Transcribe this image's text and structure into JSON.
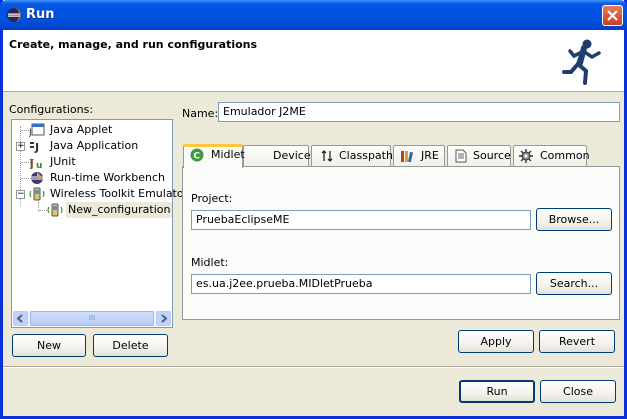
{
  "window": {
    "title": "Run"
  },
  "banner": {
    "title": "Create, manage, and run configurations"
  },
  "configurations": {
    "label": "Configurations:",
    "items": [
      {
        "label": "Java Applet"
      },
      {
        "label": "Java Application"
      },
      {
        "label": "JUnit"
      },
      {
        "label": "Run-time Workbench"
      },
      {
        "label": "Wireless Toolkit Emulator"
      },
      {
        "label": "New_configuration"
      }
    ],
    "scroll_thumb_grip": "III"
  },
  "left_buttons": {
    "new": "New",
    "delete": "Delete"
  },
  "name": {
    "label": "Name:",
    "value": "Emulador J2ME"
  },
  "tabs": [
    {
      "label": "Midlet"
    },
    {
      "label": "Device"
    },
    {
      "label": "Classpath"
    },
    {
      "label": "JRE"
    },
    {
      "label": "Source"
    },
    {
      "label": "Common"
    }
  ],
  "midlet_tab": {
    "project_label": "Project:",
    "project_value": "PruebaEclipseME",
    "browse_button": "Browse...",
    "midlet_label": "Midlet:",
    "midlet_value": "es.ua.j2ee.prueba.MIDletPrueba",
    "search_button": "Search..."
  },
  "actions": {
    "apply": "Apply",
    "revert": "Revert"
  },
  "dialog_buttons": {
    "run": "Run",
    "close": "Close"
  },
  "colors": {
    "titlebar": "#0054e3",
    "dialog_bg": "#ece9d8",
    "active_tab_accent": "#ffc83c",
    "close_button": "#c8401f"
  }
}
